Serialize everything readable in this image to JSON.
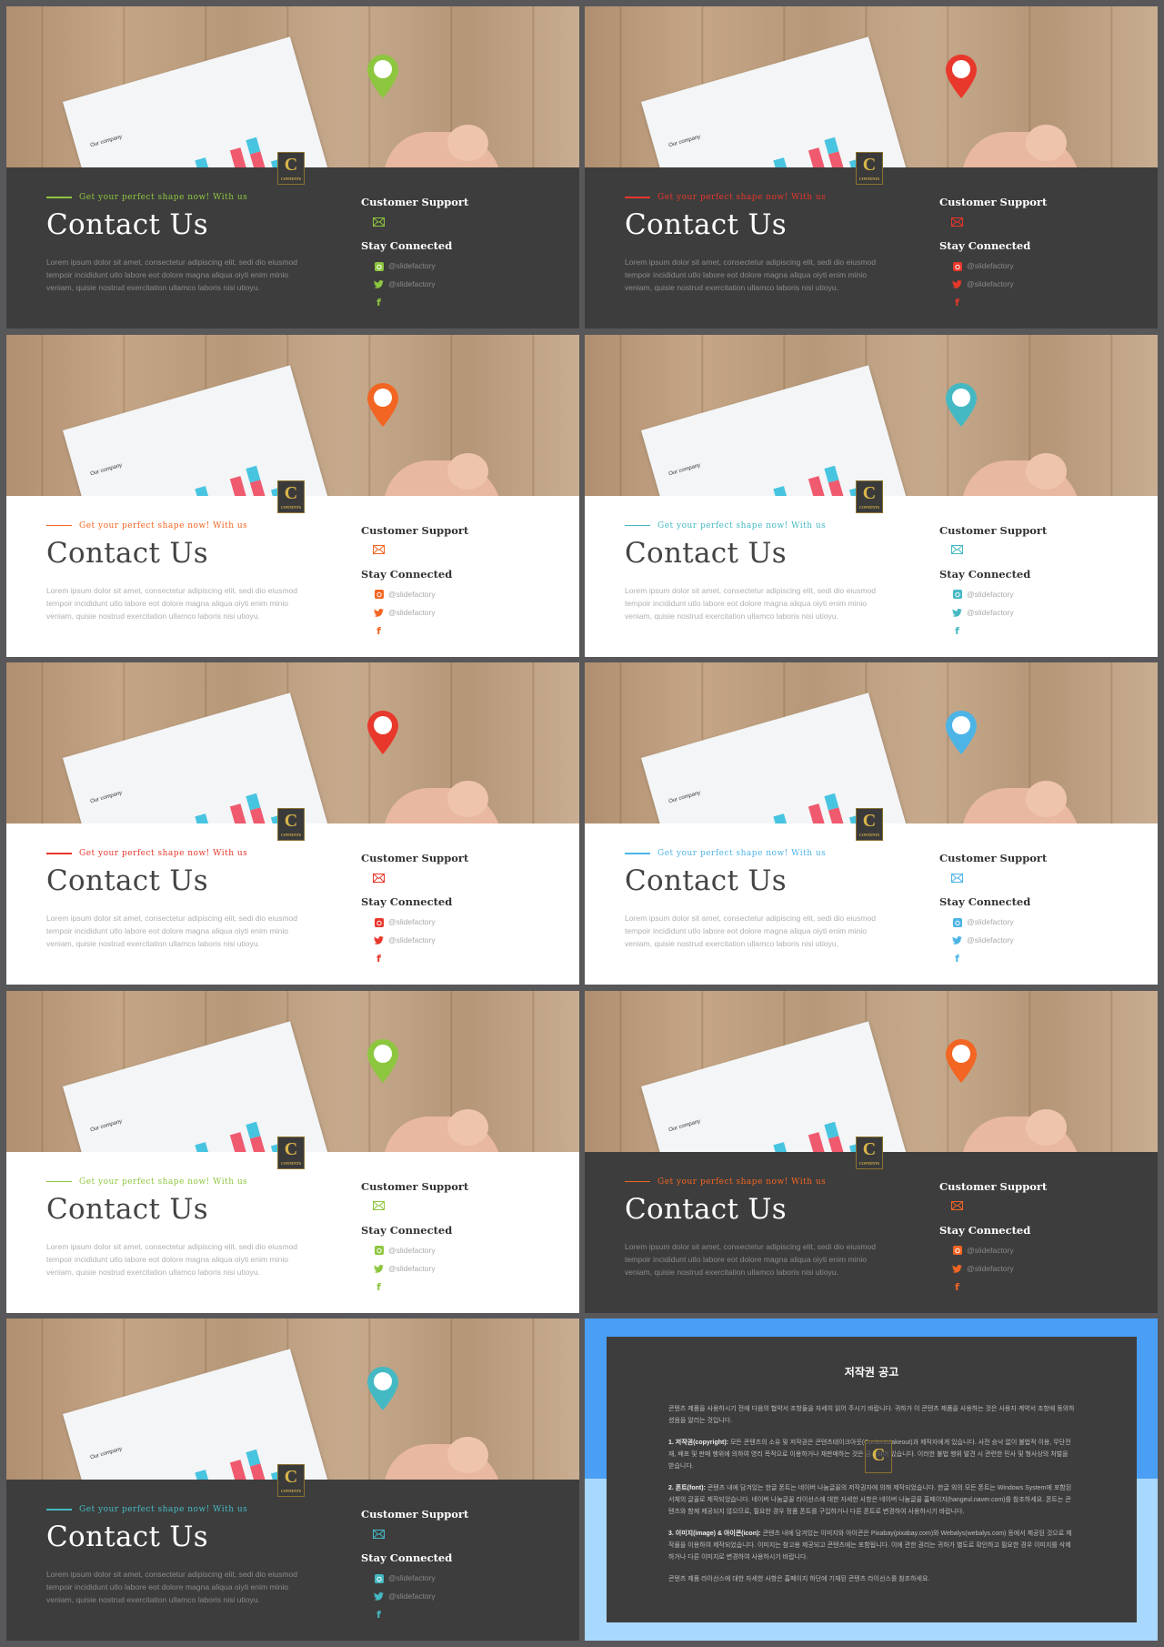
{
  "contact": {
    "tagline": "Get your perfect shape now!  With us",
    "title": "Contact Us",
    "lorem": "Lorem ipsum dolor sit amet, consectetur adipiscing elit, sedi dio eiusmod tempoir incididunt utlo labore eot dolore magna aliqua oiyti enim minio veniam, quisie nostrud exercitation ullamco laboris nisi utioyu.",
    "customer_support": "Customer Support",
    "stay_connected": "Stay Connected",
    "instagram_handle": "@slidefactory",
    "twitter_handle": "@slidefactory",
    "photo_paper_title": "Our company",
    "logo_text": "CONTENTS"
  },
  "icons": [
    "pin-icon",
    "mail-icon",
    "instagram-icon",
    "twitter-icon",
    "facebook-icon"
  ],
  "slides": [
    {
      "theme": "dark",
      "accent": "#8dc63f"
    },
    {
      "theme": "dark",
      "accent": "#e8372b"
    },
    {
      "theme": "light",
      "accent": "#f26522"
    },
    {
      "theme": "light",
      "accent": "#45b9c3"
    },
    {
      "theme": "light",
      "accent": "#e8372b"
    },
    {
      "theme": "light",
      "accent": "#4db4e6"
    },
    {
      "theme": "light",
      "accent": "#8dc63f"
    },
    {
      "theme": "dark",
      "accent": "#f26522"
    },
    {
      "theme": "dark",
      "accent": "#45b9c3"
    }
  ],
  "copyright": {
    "title": "저작권 공고",
    "intro": "콘텐츠 제품을 사용하시기 전에 다음의 협약서 조항들을 자세히 읽어 주시기 바랍니다. 귀하가 이 콘텐츠 제품을 사용하는 것은 사용자 계약서 조항에 동의하셨음을 알리는 것입니다.",
    "items": [
      {
        "label": "1. 저작권(copyright):",
        "text": "모든 콘텐츠의 소유 및 저작권은 콘텐츠테이크아웃(Contentstakeout)과 제작자에게 있습니다. 사전 승낙 없이 불법적 이용, 무단전재, 배포 및 판매 행위에 의하여 영리 목적으로 이용하거나 재판매하는 것은 금지되어 있습니다. 이러한 불법 행위 발견 시 관련한 민사 및 형사상의 처벌을 받습니다."
      },
      {
        "label": "2. 폰트(font):",
        "text": "콘텐츠 내에 담겨있는 한글 폰트는 네이버 나눔글꼴의 저작권자에 의해 제작되었습니다. 한글 외의 모든 폰트는 Windows System에 포함된 서체의 글꼴로 제작되었습니다. 네이버 나눔글꼴 라이선스에 대한 자세한 사항은 네이버 나눔글꼴 홈페이지(hangeul.naver.com)를 참조하세요. 폰트는 콘텐츠와 함께 제공되지 않으므로, 필요한 경우 정품 폰트를 구입하거나 다른 폰트로 변경하여 사용하시기 바랍니다."
      },
      {
        "label": "3. 이미지(image) & 아이콘(icon):",
        "text": "콘텐츠 내에 담겨있는 이미지와 아이콘은 Pixabay(pixabay.com)와 Webalys(webalys.com) 등에서 제공된 것으로 제작물을 이용하여 제작되었습니다. 이미지는 참고용 제공되고 콘텐츠에는 포함됩니다. 이에 관한 권리는 귀하가 별도로 확인하고 필요한 경우 이미지를 삭제하거나 다른 이미지로 변경하여 사용하시기 바랍니다."
      }
    ],
    "outro": "콘텐츠 제품 라이선스에 대한 자세한 사항은 홈페이지 하단에 기재된 콘텐츠 라이선스를 참조하세요."
  }
}
